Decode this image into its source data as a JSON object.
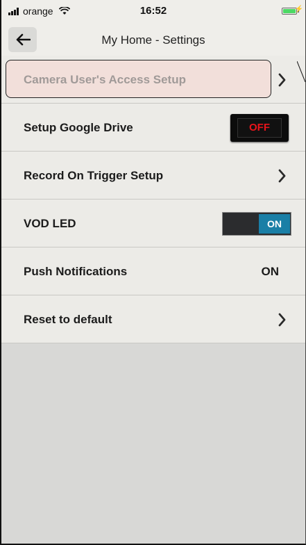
{
  "status_bar": {
    "carrier": "orange",
    "time": "16:52"
  },
  "nav": {
    "title": "My Home - Settings",
    "back_icon": "back-arrow-icon"
  },
  "rows": [
    {
      "label": "Camera User's Access Setup",
      "control": "chevron",
      "highlighted": true
    },
    {
      "label": "Setup Google Drive",
      "control": "toggle",
      "toggle_text": "OFF"
    },
    {
      "label": "Record On Trigger Setup",
      "control": "chevron"
    },
    {
      "label": "VOD LED",
      "control": "switch",
      "switch_text": "ON"
    },
    {
      "label": "Push Notifications",
      "control": "value",
      "value": "ON"
    },
    {
      "label": "Reset to default",
      "control": "chevron"
    }
  ],
  "colors": {
    "highlight_bg": "#f2dfda",
    "off_text": "#e8141b",
    "on_switch": "#1a7fa6",
    "battery": "#4cd964"
  }
}
